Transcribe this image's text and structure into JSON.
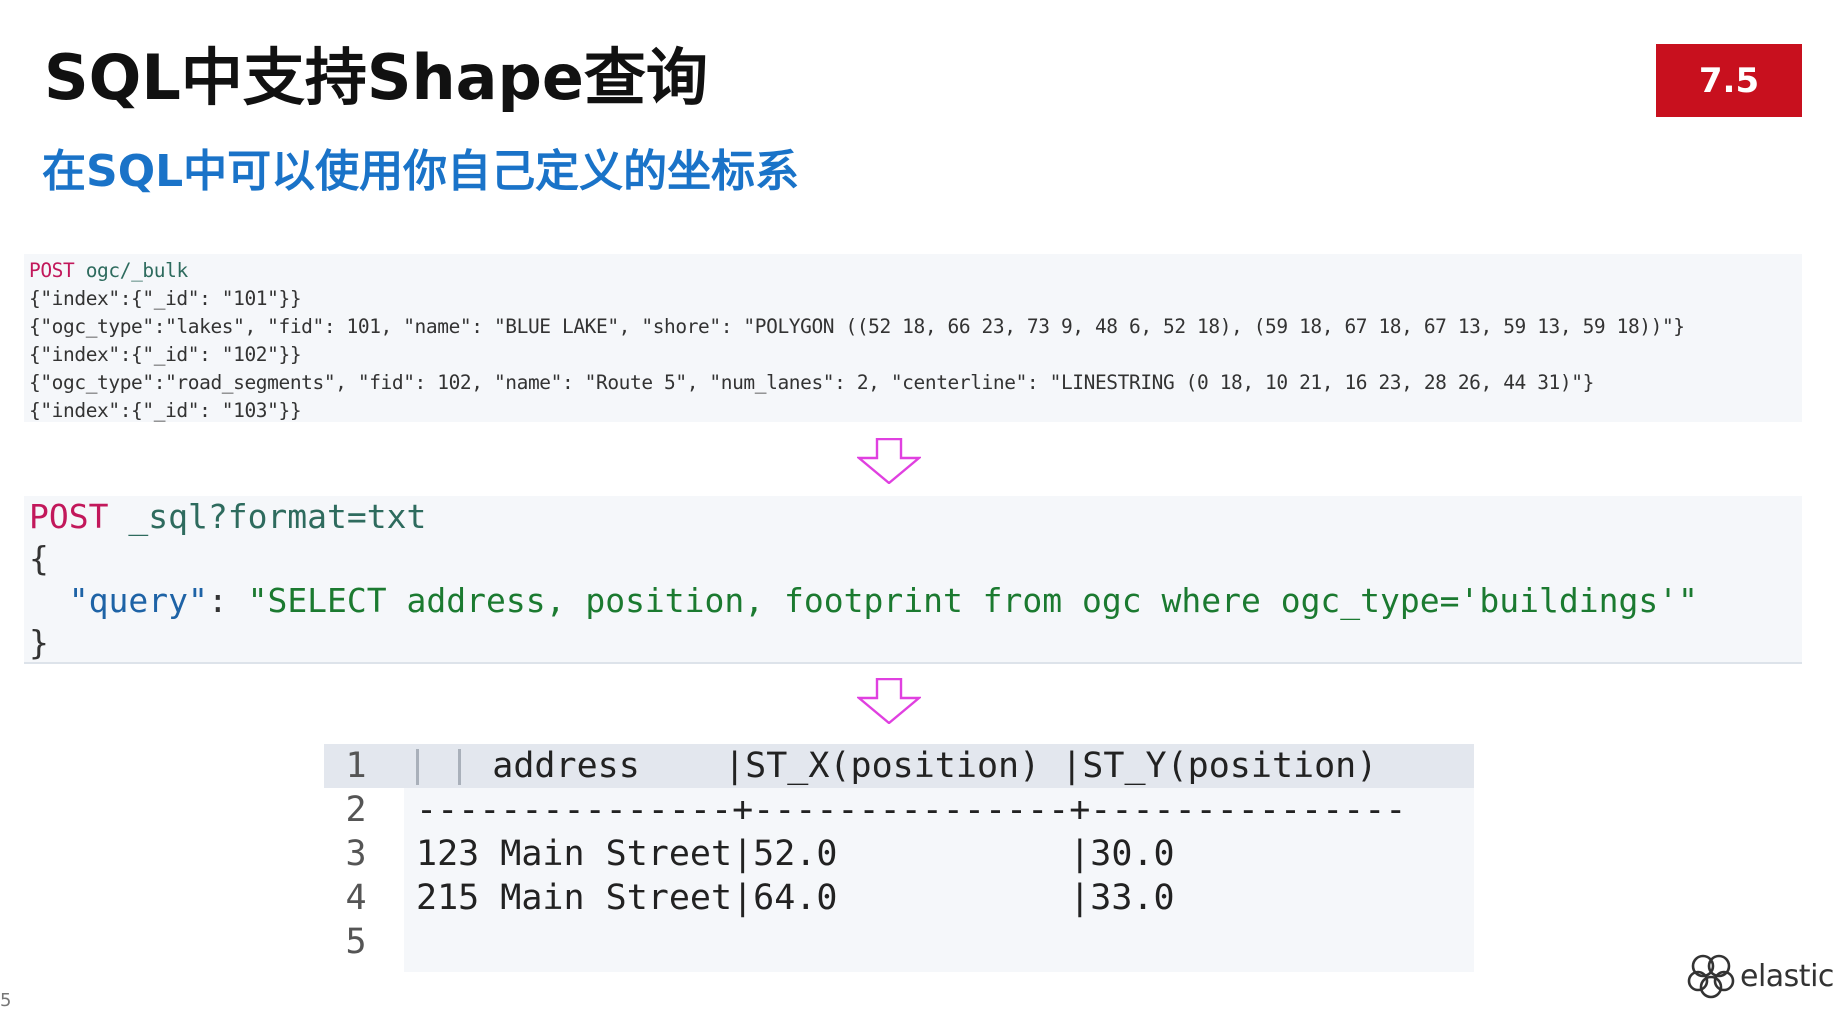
{
  "slide": {
    "title": "SQL中支持Shape查询",
    "version": "7.5",
    "subtitle": "在SQL中可以使用你自己定义的坐标系",
    "page_number": "5",
    "logo_text": "elastic"
  },
  "bulk_request": {
    "method": "POST",
    "path": "ogc/_bulk",
    "lines": [
      "{\"index\":{\"_id\": \"101\"}}",
      "{\"ogc_type\":\"lakes\", \"fid\": 101, \"name\": \"BLUE LAKE\", \"shore\": \"POLYGON ((52 18, 66 23, 73 9, 48 6, 52 18), (59 18, 67 18, 67 13, 59 13, 59 18))\"}",
      "{\"index\":{\"_id\": \"102\"}}",
      "{\"ogc_type\":\"road_segments\", \"fid\": 102, \"name\": \"Route 5\", \"num_lanes\": 2, \"centerline\": \"LINESTRING (0 18, 10 21, 16 23, 28 26, 44 31)\"}",
      "{\"index\":{\"_id\": \"103\"}}"
    ]
  },
  "sql_request": {
    "method": "POST",
    "path": "_sql?format=txt",
    "open_brace": "{",
    "query_key": "\"query\"",
    "colon": ": ",
    "query_value": "\"SELECT address, position, footprint from ogc where ogc_type='buildings'\"",
    "close_brace": "}"
  },
  "result": {
    "line_numbers": [
      "1",
      "2",
      "3",
      "4",
      "5"
    ],
    "header": "    address    |ST_X(position) |ST_Y(position)",
    "divider": "---------------+---------------+---------------",
    "rows": [
      "123 Main Street|52.0           |30.0",
      "215 Main Street|64.0           |33.0"
    ]
  },
  "colors": {
    "title": "#111111",
    "subtitle": "#1a73c8",
    "badge": "#c8101e",
    "arrow": "#e040e0",
    "keyword": "#c2185b"
  }
}
